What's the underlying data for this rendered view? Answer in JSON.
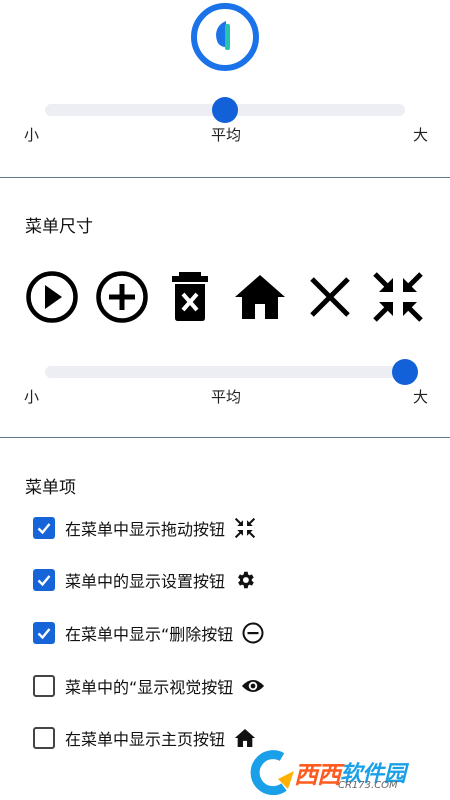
{
  "size_slider": {
    "min_label": "小",
    "mid_label": "平均",
    "max_label": "大",
    "value_fraction": 0.5
  },
  "menu_size": {
    "title": "菜单尺寸",
    "icons": [
      "play-circle-icon",
      "add-circle-icon",
      "delete-bin-icon",
      "home-icon",
      "close-icon",
      "collapse-arrows-icon"
    ],
    "slider": {
      "min_label": "小",
      "mid_label": "平均",
      "max_label": "大",
      "value_fraction": 1.0
    }
  },
  "menu_items": {
    "title": "菜单项",
    "items": [
      {
        "label": "在菜单中显示拖动按钮",
        "checked": true,
        "icon": "drag-collapse-icon"
      },
      {
        "label": "菜单中的显示设置按钮",
        "checked": true,
        "icon": "gear-icon"
      },
      {
        "label": "在菜单中显示“删除按钮",
        "checked": true,
        "icon": "remove-circle-icon"
      },
      {
        "label": "菜单中的“显示视觉按钮",
        "checked": false,
        "icon": "eye-icon"
      },
      {
        "label": "在菜单中显示主页按钮",
        "checked": false,
        "icon": "home-icon"
      }
    ]
  },
  "watermark": {
    "brand_a": "西西",
    "brand_b": "软件园",
    "url": "CR173.COM"
  },
  "colors": {
    "accent": "#1361d8",
    "divider": "#5f7c8a"
  }
}
